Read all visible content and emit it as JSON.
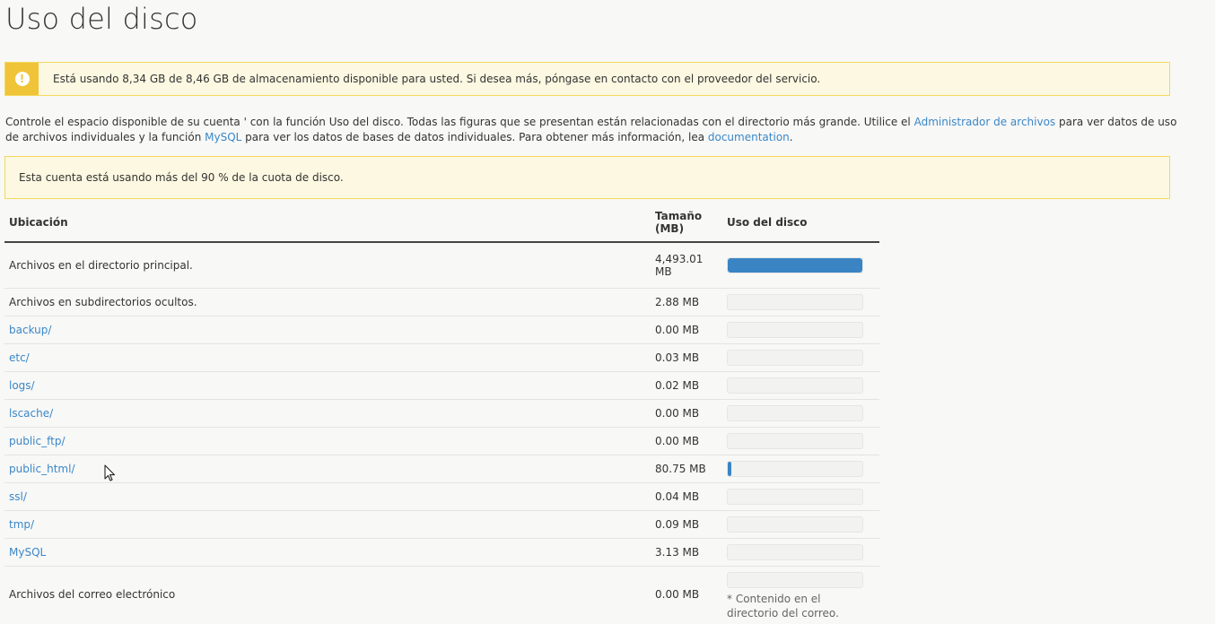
{
  "page": {
    "title": "Uso del disco"
  },
  "quota_alert": {
    "text": "Está usando 8,34 GB de 8,46 GB de almacenamiento disponible para usted. Si desea más, póngase en contacto con el proveedor del servicio.",
    "icon": "warning-icon",
    "color": "#f0c438"
  },
  "intro": {
    "part1": "Controle el espacio disponible de su cuenta ' con la función Uso del disco. Todas las figuras que se presentan están relacionadas con el directorio más grande. Utilice el ",
    "link_file_manager": "Administrador de archivos",
    "part2": " para ver datos de uso de archivos individuales y la función ",
    "link_mysql": "MySQL",
    "part3": " para ver los datos de bases de datos individuales. Para obtener más información, lea ",
    "link_docs": "documentation",
    "part4": "."
  },
  "warning_alert": {
    "text": "Esta cuenta está usando más del 90 % de la cuota de disco."
  },
  "table": {
    "headers": {
      "location": "Ubicación",
      "size": "Tamaño (MB)",
      "usage": "Uso del disco"
    },
    "rows": [
      {
        "location": "Archivos en el directorio principal.",
        "size": "4,493.01 MB",
        "link": false,
        "usage_fraction": 1.0
      },
      {
        "location": "Archivos en subdirectorios ocultos.",
        "size": "2.88 MB",
        "link": false,
        "usage_fraction": 0
      },
      {
        "location": "backup/",
        "size": "0.00 MB",
        "link": true,
        "usage_fraction": 0
      },
      {
        "location": "etc/",
        "size": "0.03 MB",
        "link": true,
        "usage_fraction": 0
      },
      {
        "location": "logs/",
        "size": "0.02 MB",
        "link": true,
        "usage_fraction": 0
      },
      {
        "location": "lscache/",
        "size": "0.00 MB",
        "link": true,
        "usage_fraction": 0
      },
      {
        "location": "public_ftp/",
        "size": "0.00 MB",
        "link": true,
        "usage_fraction": 0
      },
      {
        "location": "public_html/",
        "size": "80.75 MB",
        "link": true,
        "usage_fraction": 0.018
      },
      {
        "location": "ssl/",
        "size": "0.04 MB",
        "link": true,
        "usage_fraction": 0
      },
      {
        "location": "tmp/",
        "size": "0.09 MB",
        "link": true,
        "usage_fraction": 0
      },
      {
        "location": "MySQL",
        "size": "3.13 MB",
        "link": true,
        "usage_fraction": 0
      },
      {
        "location": "Archivos del correo electrónico",
        "size": "0.00 MB",
        "link": false,
        "usage_fraction": 0,
        "note": "* Contenido en el directorio del correo."
      }
    ],
    "bar_color": "#3a84c4"
  }
}
